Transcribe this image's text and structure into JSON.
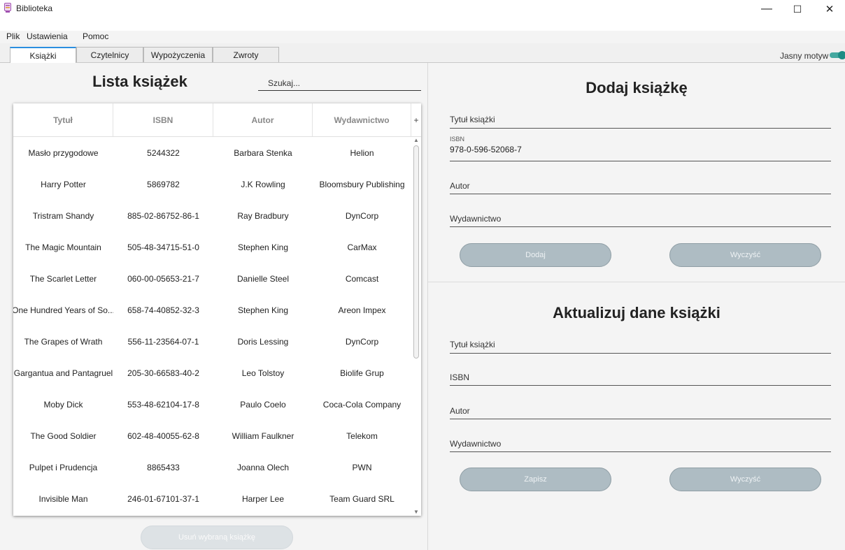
{
  "window": {
    "title": "Biblioteka",
    "minimize": "—",
    "maximize": "☐",
    "close": "✕"
  },
  "menu": [
    "Plik",
    "Ustawienia",
    "Pomoc"
  ],
  "tabs": [
    "Książki",
    "Czytelnicy",
    "Wypożyczenia",
    "Zwroty"
  ],
  "theme": {
    "label": "Jasny motyw",
    "enabled": true
  },
  "list": {
    "title": "Lista książek",
    "search_placeholder": "Szukaj...",
    "columns": [
      "Tytuł",
      "ISBN",
      "Autor",
      "Wydawnictwo"
    ],
    "column_menu": "+",
    "rows": [
      [
        "Masło przygodowe",
        "5244322",
        "Barbara Stenka",
        "Helion"
      ],
      [
        "Harry Potter",
        "5869782",
        "J.K Rowling",
        "Bloomsbury Publishing"
      ],
      [
        "Tristram Shandy",
        "885-02-86752-86-1",
        "Ray Bradbury",
        "DynCorp"
      ],
      [
        "The Magic Mountain",
        "505-48-34715-51-0",
        "Stephen King",
        "CarMax"
      ],
      [
        "The Scarlet Letter",
        "060-00-05653-21-7",
        "Danielle Steel",
        "Comcast"
      ],
      [
        "One Hundred Years of So...",
        "658-74-40852-32-3",
        "Stephen King",
        "Areon Impex"
      ],
      [
        "The Grapes of Wrath",
        "556-11-23564-07-1",
        "Doris Lessing",
        "DynCorp"
      ],
      [
        "Gargantua and Pantagruel",
        "205-30-66583-40-2",
        "Leo Tolstoy",
        "Biolife Grup"
      ],
      [
        "Moby Dick",
        "553-48-62104-17-8",
        "Paulo Coelo",
        "Coca-Cola Company"
      ],
      [
        "The Good Soldier",
        "602-48-40055-62-8",
        "William Faulkner",
        "Telekom"
      ],
      [
        "Pulpet i Prudencja",
        "8865433",
        "Joanna Olech",
        "PWN"
      ],
      [
        "Invisible Man",
        "246-01-67101-37-1",
        "Harper Lee",
        "Team Guard SRL"
      ]
    ],
    "delete_label": "Usuń wybraną książkę"
  },
  "add": {
    "title": "Dodaj książkę",
    "title_label": "Tytuł książki",
    "isbn_label": "ISBN",
    "isbn_value": "978-0-596-52068-7",
    "author_label": "Autor",
    "publisher_label": "Wydawnictwo",
    "add_label": "Dodaj",
    "clear_label": "Wyczyść"
  },
  "update": {
    "title": "Aktualizuj dane książki",
    "title_label": "Tytuł książki",
    "isbn_label": "ISBN",
    "author_label": "Autor",
    "publisher_label": "Wydawnictwo",
    "save_label": "Zapisz",
    "clear_label": "Wyczyść"
  }
}
